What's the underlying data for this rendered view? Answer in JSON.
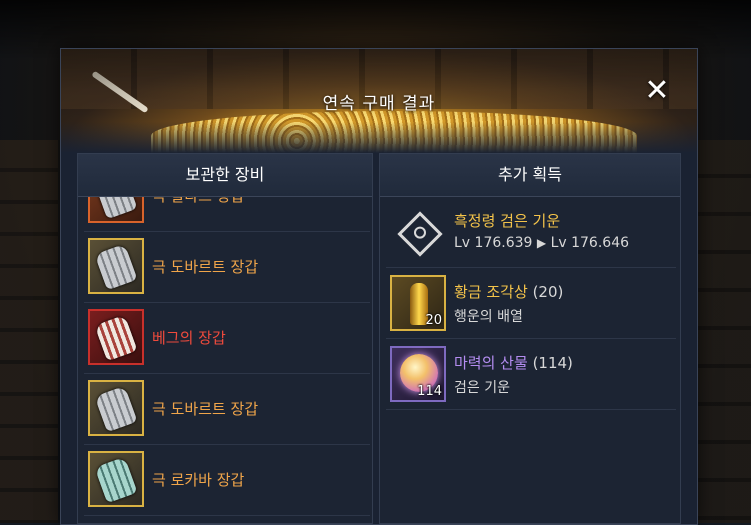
{
  "dialog": {
    "title": "연속 구매 결과",
    "close_label": "✕"
  },
  "left_panel": {
    "header": "보관한 장비",
    "items": [
      {
        "name": "극 칼라스 장갑",
        "grade": "orange",
        "icon": "gauntlet-icon"
      },
      {
        "name": "극 도바르트 장갑",
        "grade": "gold",
        "icon": "gauntlet-icon"
      },
      {
        "name": "베그의 장갑",
        "grade": "red",
        "icon": "gauntlet-icon"
      },
      {
        "name": "극 도바르트 장갑",
        "grade": "gold",
        "icon": "gauntlet-icon"
      },
      {
        "name": "극 로카바 장갑",
        "grade": "gold",
        "icon": "gauntlet-icon"
      }
    ]
  },
  "right_panel": {
    "header": "추가 획득",
    "items": [
      {
        "name": "흑정령 검은 기운",
        "count": "",
        "qty": "",
        "detail_from": "Lv 176.639",
        "detail_arrow": "▶",
        "detail_to": "Lv 176.646",
        "icon": "black-spirit-icon"
      },
      {
        "name": "황금 조각상",
        "count": "(20)",
        "qty": "20",
        "detail": "행운의 배열",
        "icon": "golden-statue-icon"
      },
      {
        "name": "마력의 산물",
        "count": "(114)",
        "qty": "114",
        "detail": "검은 기운",
        "icon": "mana-orb-icon"
      }
    ]
  },
  "colors": {
    "accent_gold": "#f3c34a",
    "grade_orange": "#f0a54a",
    "grade_red": "#ee4a3c",
    "grade_purple": "#b38cf0",
    "panel_bg": "#1c2433"
  }
}
